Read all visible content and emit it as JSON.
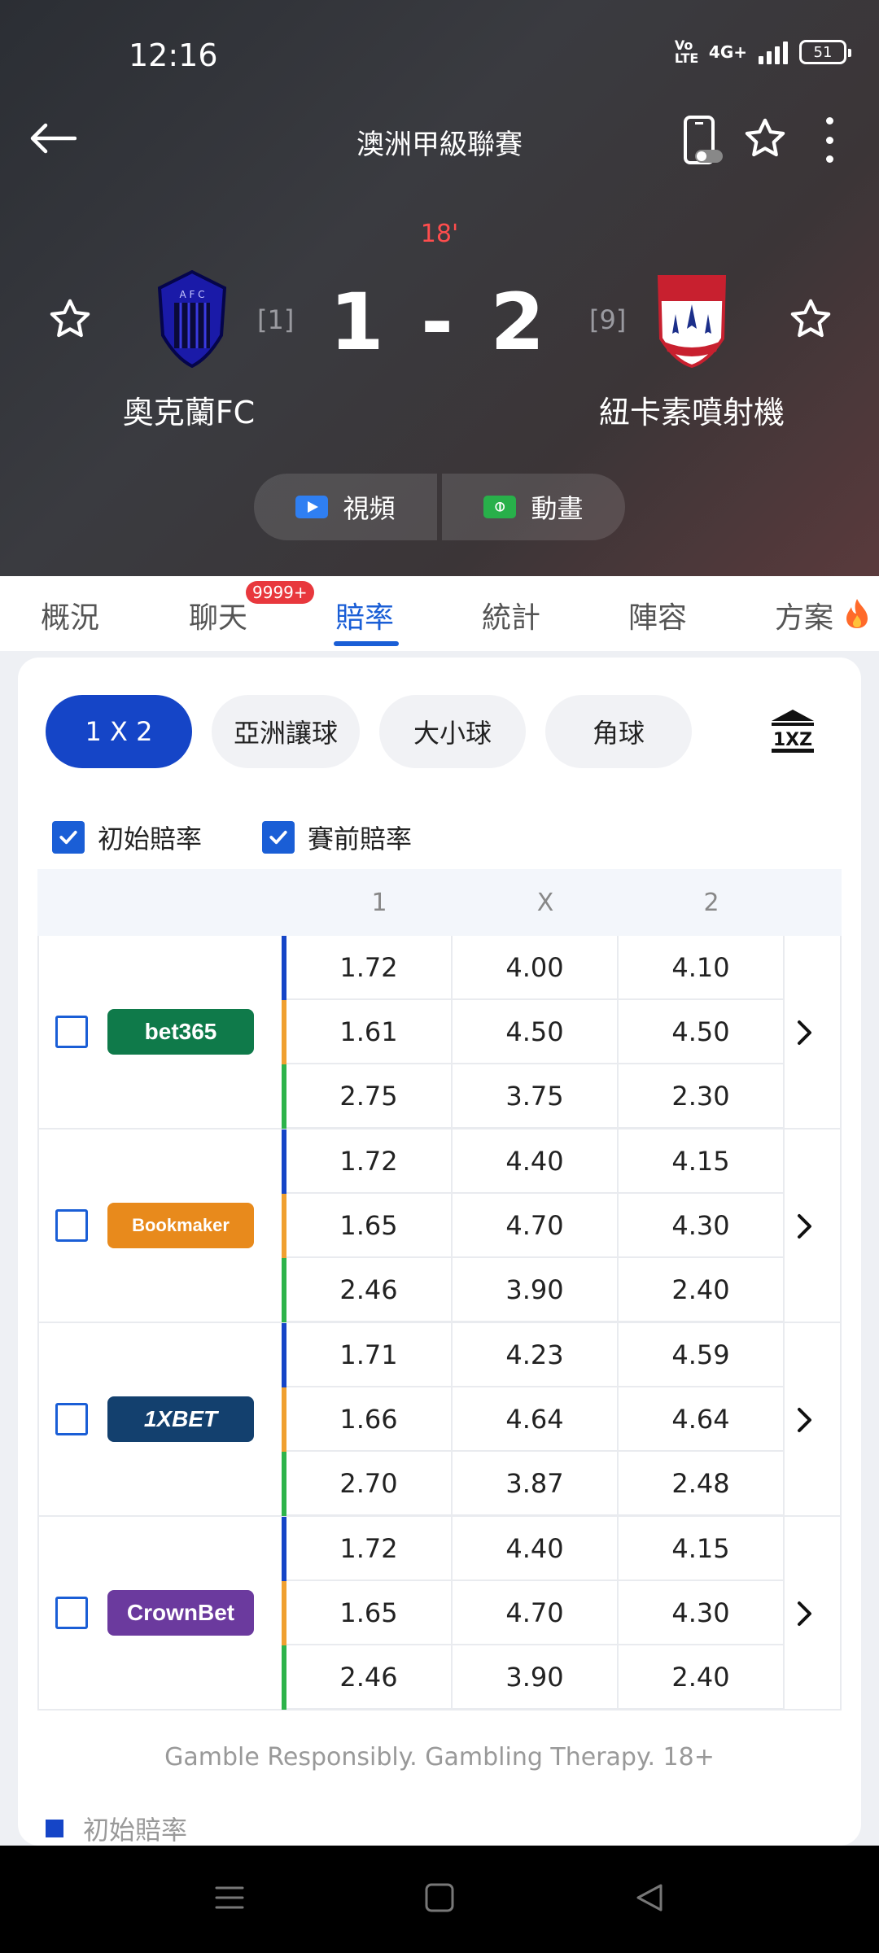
{
  "status_bar": {
    "time": "12:16",
    "volte": "Vo LTE",
    "network": "4G+",
    "battery": "51"
  },
  "header": {
    "league": "澳洲甲級聯賽",
    "minute": "18'",
    "score": "1 - 2",
    "home": {
      "name": "奧克蘭FC",
      "rank": "[1]"
    },
    "away": {
      "name": "紐卡素噴射機",
      "rank": "[9]"
    },
    "media": {
      "video_label": "視頻",
      "animation_label": "動畫"
    }
  },
  "tabs": [
    {
      "label": "概況"
    },
    {
      "label": "聊天",
      "badge": "9999+"
    },
    {
      "label": "賠率",
      "active": true
    },
    {
      "label": "統計"
    },
    {
      "label": "陣容"
    },
    {
      "label": "方案"
    }
  ],
  "odds": {
    "market_tabs": [
      "1 X 2",
      "亞洲讓球",
      "大小球",
      "角球"
    ],
    "filters": {
      "initial": "初始賠率",
      "prematch": "賽前賠率"
    },
    "columns": [
      "1",
      "X",
      "2"
    ],
    "bookmakers": [
      {
        "name": "bet365",
        "rows": [
          [
            "1.72",
            "4.00",
            "4.10"
          ],
          [
            "1.61",
            "4.50",
            "4.50"
          ],
          [
            "2.75",
            "3.75",
            "2.30"
          ]
        ]
      },
      {
        "name": "Bookmaker",
        "rows": [
          [
            "1.72",
            "4.40",
            "4.15"
          ],
          [
            "1.65",
            "4.70",
            "4.30"
          ],
          [
            "2.46",
            "3.90",
            "2.40"
          ]
        ]
      },
      {
        "name": "1XBET",
        "rows": [
          [
            "1.71",
            "4.23",
            "4.59"
          ],
          [
            "1.66",
            "4.64",
            "4.64"
          ],
          [
            "2.70",
            "3.87",
            "2.48"
          ]
        ]
      },
      {
        "name": "CrownBet",
        "rows": [
          [
            "1.72",
            "4.40",
            "4.15"
          ],
          [
            "1.65",
            "4.70",
            "4.30"
          ],
          [
            "2.46",
            "3.90",
            "2.40"
          ]
        ]
      }
    ],
    "footer": "Gamble Responsibly. Gambling Therapy. 18+",
    "legend_initial": "初始賠率"
  },
  "colors": {
    "accent": "#1a5ed6",
    "bar_initial": "#1545c7",
    "bar_prematch": "#f0a030",
    "bar_live": "#2db34a",
    "live_red": "#ff4d4d"
  }
}
